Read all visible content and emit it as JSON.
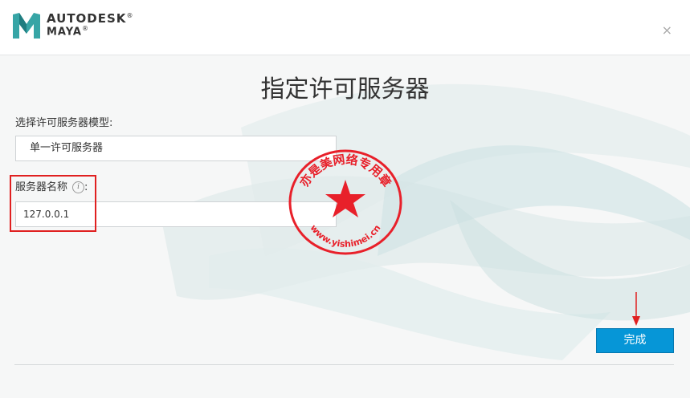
{
  "header": {
    "brand_line1": "AUTODESK",
    "brand_line2": "MAYA",
    "reg_mark": "®",
    "close_glyph": "×"
  },
  "page_title": "指定许可服务器",
  "license_model": {
    "label": "选择许可服务器模型:",
    "value": "单一许可服务器"
  },
  "server_name": {
    "label": "服务器名称",
    "suffix": ":",
    "info_glyph": "i",
    "value": "127.0.0.1"
  },
  "finish_button": {
    "label": "完成"
  },
  "watermark": {
    "top_text": "亦是美网络专用章",
    "bottom_text": "www.yishimei.cn",
    "color": "#e8202a"
  },
  "colors": {
    "accent": "#0696d7",
    "highlight": "#e02020"
  }
}
